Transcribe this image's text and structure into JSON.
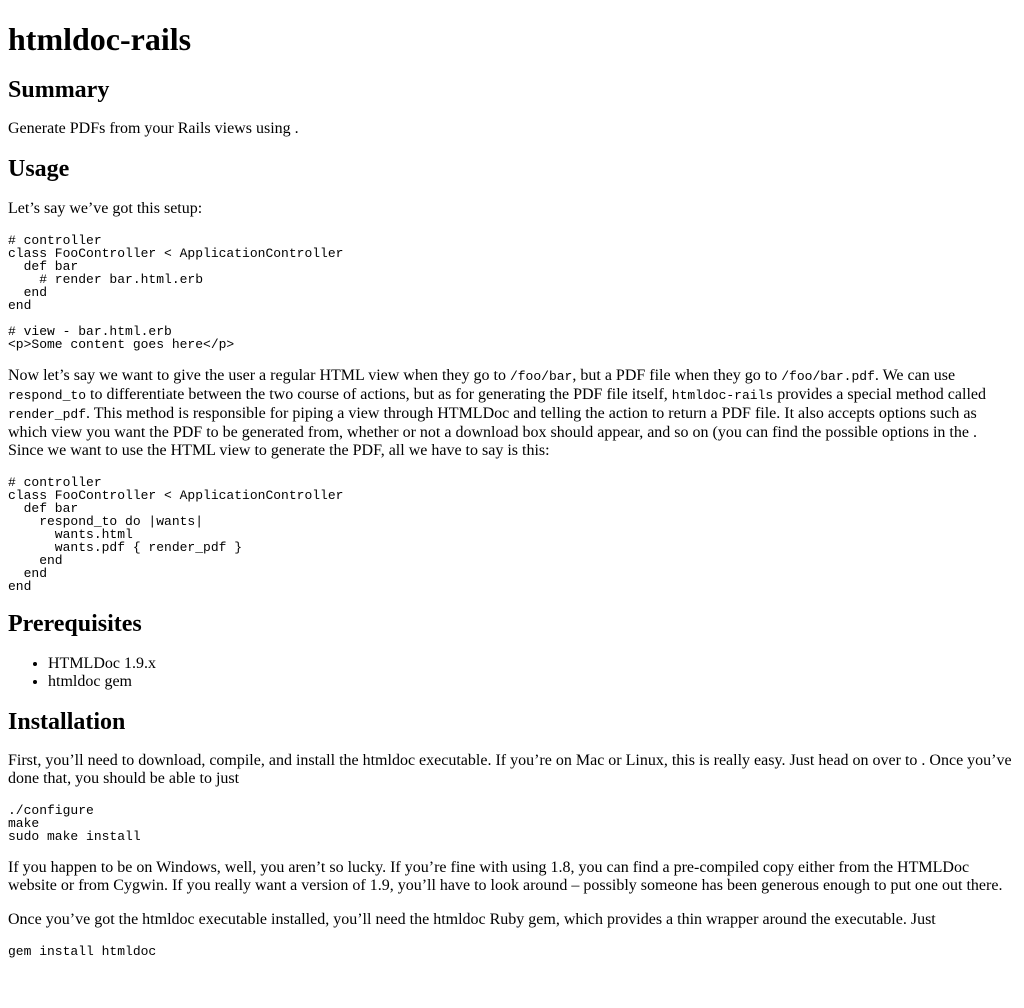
{
  "title": "htmldoc-rails",
  "summary": {
    "heading": "Summary",
    "text": "Generate PDFs from your Rails views using ."
  },
  "usage": {
    "heading": "Usage",
    "intro": "Let’s say we’ve got this setup:",
    "code1": "# controller\nclass FooController < ApplicationController\n  def bar\n    # render bar.html.erb\n  end\nend\n\n# view - bar.html.erb\n<p>Some content goes here</p>",
    "para": {
      "t1": "Now let’s say we want to give the user a regular HTML view when they go to ",
      "c1": "/foo/bar",
      "t2": ", but a PDF file when they go to ",
      "c2": "/foo/bar.pdf",
      "t3": ". We can use ",
      "c3": "respond_to",
      "t4": " to differentiate between the two course of actions, but as for generating the PDF file itself, ",
      "c4": "htmldoc-rails",
      "t5": " provides a special method called ",
      "c5": "render_pdf",
      "t6": ". This method is responsible for piping a view through HTMLDoc and telling the action to return a PDF file. It also accepts options such as which view you want the PDF to be generated from, whether or not a download box should appear, and so on (you can find the possible options in the . Since we want to use the HTML view to generate the PDF, all we have to say is this:"
    },
    "code2": "# controller\nclass FooController < ApplicationController\n  def bar\n    respond_to do |wants|\n      wants.html\n      wants.pdf { render_pdf }\n    end\n  end\nend"
  },
  "prerequisites": {
    "heading": "Prerequisites",
    "items": [
      "HTMLDoc 1.9.x",
      "htmldoc gem"
    ]
  },
  "installation": {
    "heading": "Installation",
    "para1": "First, you’ll need to download, compile, and install the htmldoc executable. If you’re on Mac or Linux, this is really easy. Just head on over to . Once you’ve done that, you should be able to just",
    "code1": "./configure\nmake\nsudo make install",
    "para2": "If you happen to be on Windows, well, you aren’t so lucky. If you’re fine with using 1.8, you can find a pre-compiled copy either from the HTMLDoc website or from Cygwin. If you really want a version of 1.9, you’ll have to look around – possibly someone has been generous enough to put one out there.",
    "para3": "Once you’ve got the htmldoc executable installed, you’ll need the htmldoc Ruby gem, which provides a thin wrapper around the executable. Just",
    "code2": "gem install htmldoc"
  }
}
